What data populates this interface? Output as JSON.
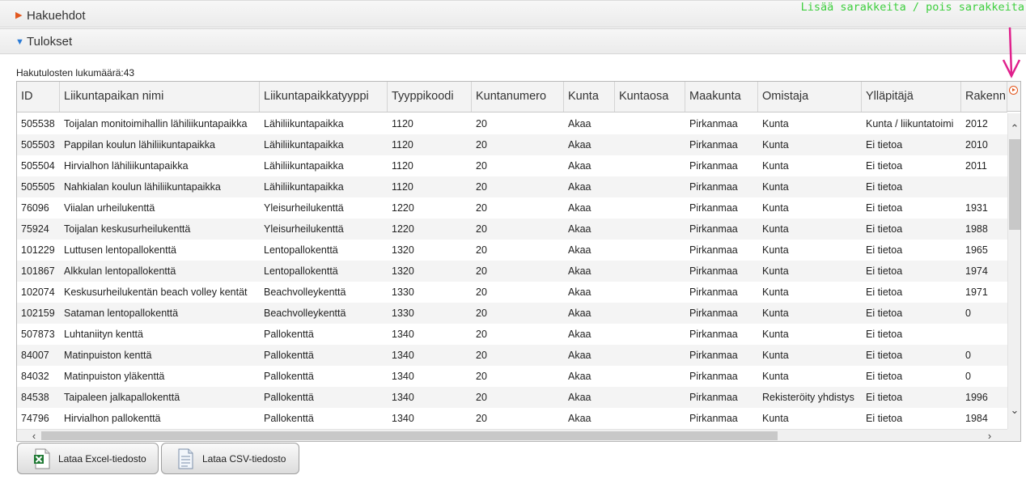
{
  "sections": {
    "criteria_label": "Hakuehdot",
    "results_label": "Tulokset"
  },
  "annotation": "Lisää sarakkeita / pois sarakkeita",
  "results_count": "Hakutulosten lukumäärä:43",
  "table": {
    "columns": [
      "ID",
      "Liikuntapaikan nimi",
      "Liikuntapaikkatyyppi",
      "Tyyppikoodi",
      "Kuntanumero",
      "Kunta",
      "Kuntaosa",
      "Maakunta",
      "Omistaja",
      "Ylläpitäjä",
      "Rakenn"
    ],
    "rows": [
      [
        "505538",
        "Toijalan monitoimihallin lähiliikuntapaikka",
        "Lähiliikuntapaikka",
        "1120",
        "20",
        "Akaa",
        "",
        "Pirkanmaa",
        "Kunta",
        "Kunta / liikuntatoimi",
        "2012"
      ],
      [
        "505503",
        "Pappilan koulun lähiliikuntapaikka",
        "Lähiliikuntapaikka",
        "1120",
        "20",
        "Akaa",
        "",
        "Pirkanmaa",
        "Kunta",
        "Ei tietoa",
        "2010"
      ],
      [
        "505504",
        "Hirvialhon lähiliikuntapaikka",
        "Lähiliikuntapaikka",
        "1120",
        "20",
        "Akaa",
        "",
        "Pirkanmaa",
        "Kunta",
        "Ei tietoa",
        "2011"
      ],
      [
        "505505",
        "Nahkialan koulun lähiliikuntapaikka",
        "Lähiliikuntapaikka",
        "1120",
        "20",
        "Akaa",
        "",
        "Pirkanmaa",
        "Kunta",
        "Ei tietoa",
        ""
      ],
      [
        "76096",
        "Viialan urheilukenttä",
        "Yleisurheilukenttä",
        "1220",
        "20",
        "Akaa",
        "",
        "Pirkanmaa",
        "Kunta",
        "Ei tietoa",
        "1931"
      ],
      [
        "75924",
        "Toijalan keskusurheilukenttä",
        "Yleisurheilukenttä",
        "1220",
        "20",
        "Akaa",
        "",
        "Pirkanmaa",
        "Kunta",
        "Ei tietoa",
        "1988"
      ],
      [
        "101229",
        "Luttusen lentopallokenttä",
        "Lentopallokenttä",
        "1320",
        "20",
        "Akaa",
        "",
        "Pirkanmaa",
        "Kunta",
        "Ei tietoa",
        "1965"
      ],
      [
        "101867",
        "Alkkulan lentopallokenttä",
        "Lentopallokenttä",
        "1320",
        "20",
        "Akaa",
        "",
        "Pirkanmaa",
        "Kunta",
        "Ei tietoa",
        "1974"
      ],
      [
        "102074",
        "Keskusurheilukentän beach volley kentät",
        "Beachvolleykenttä",
        "1330",
        "20",
        "Akaa",
        "",
        "Pirkanmaa",
        "Kunta",
        "Ei tietoa",
        "1971"
      ],
      [
        "102159",
        "Sataman lentopallokenttä",
        "Beachvolleykenttä",
        "1330",
        "20",
        "Akaa",
        "",
        "Pirkanmaa",
        "Kunta",
        "Ei tietoa",
        "0"
      ],
      [
        "507873",
        "Luhtaniityn kenttä",
        "Pallokenttä",
        "1340",
        "20",
        "Akaa",
        "",
        "Pirkanmaa",
        "Kunta",
        "Ei tietoa",
        ""
      ],
      [
        "84007",
        "Matinpuiston kenttä",
        "Pallokenttä",
        "1340",
        "20",
        "Akaa",
        "",
        "Pirkanmaa",
        "Kunta",
        "Ei tietoa",
        "0"
      ],
      [
        "84032",
        "Matinpuiston yläkenttä",
        "Pallokenttä",
        "1340",
        "20",
        "Akaa",
        "",
        "Pirkanmaa",
        "Kunta",
        "Ei tietoa",
        "0"
      ],
      [
        "84538",
        "Taipaleen jalkapallokenttä",
        "Pallokenttä",
        "1340",
        "20",
        "Akaa",
        "",
        "Pirkanmaa",
        "Rekisteröity yhdistys",
        "Ei tietoa",
        "1996"
      ],
      [
        "74796",
        "Hirvialhon pallokenttä",
        "Pallokenttä",
        "1340",
        "20",
        "Akaa",
        "",
        "Pirkanmaa",
        "Kunta",
        "Ei tietoa",
        "1984"
      ]
    ]
  },
  "buttons": {
    "excel_label": "Lataa Excel-tiedosto",
    "csv_label": "Lataa CSV-tiedosto"
  },
  "icons": {
    "criteria_toggle": "triangle-right-icon",
    "results_toggle": "triangle-down-icon",
    "column_toggle": "add-remove-columns-icon",
    "excel": "excel-file-icon",
    "csv": "csv-file-icon"
  },
  "colors": {
    "annotation": "#3ecf3e",
    "arrow": "#e0208c",
    "accent_orange": "#e2571e",
    "accent_blue": "#2b7bd6"
  }
}
